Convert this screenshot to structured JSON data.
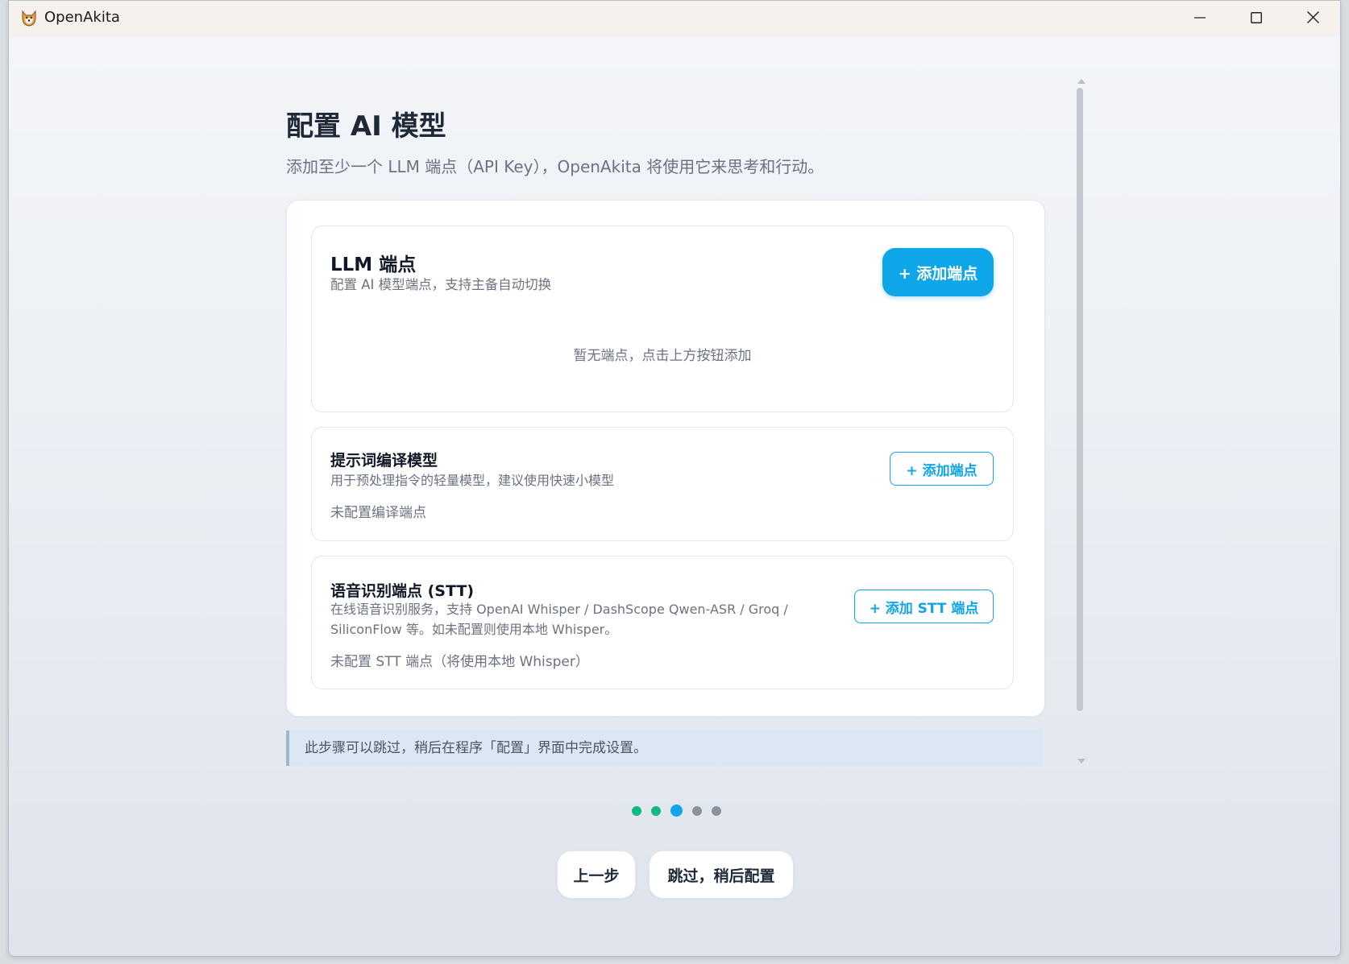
{
  "window": {
    "title": "OpenAkita"
  },
  "page": {
    "title": "配置 AI 模型",
    "subtitle": "添加至少一个 LLM 端点（API Key），OpenAkita 将使用它来思考和行动。"
  },
  "llm": {
    "title": "LLM 端点",
    "description": "配置 AI 模型端点，支持主备自动切换",
    "add_button": "+ 添加端点",
    "empty_hint": "暂无端点，点击上方按钮添加"
  },
  "compile": {
    "title": "提示词编译模型",
    "description": "用于预处理指令的轻量模型，建议使用快速小模型",
    "status": "未配置编译端点",
    "add_button": "+ 添加端点"
  },
  "stt": {
    "title": "语音识别端点 (STT)",
    "description_line1": "在线语音识别服务，支持 OpenAI Whisper / DashScope Qwen-ASR / Groq /",
    "description_line2": "SiliconFlow 等。如未配置则使用本地 Whisper。",
    "status": "未配置 STT 端点（将使用本地 Whisper）",
    "add_button": "+ 添加 STT 端点"
  },
  "notice": "此步骤可以跳过，稍后在程序「配置」界面中完成设置。",
  "steps": {
    "total": 5,
    "current": 3,
    "states": [
      "done",
      "done",
      "active",
      "pending",
      "pending"
    ]
  },
  "nav": {
    "prev_label": "上一步",
    "skip_label": "跳过，稍后配置"
  },
  "colors": {
    "accent": "#0ea5e9",
    "done": "#10b981",
    "pending": "#8a929c"
  },
  "icons": {
    "app": "akita-logo-icon",
    "minimize": "minimize-icon",
    "maximize": "maximize-icon",
    "close": "close-icon"
  }
}
